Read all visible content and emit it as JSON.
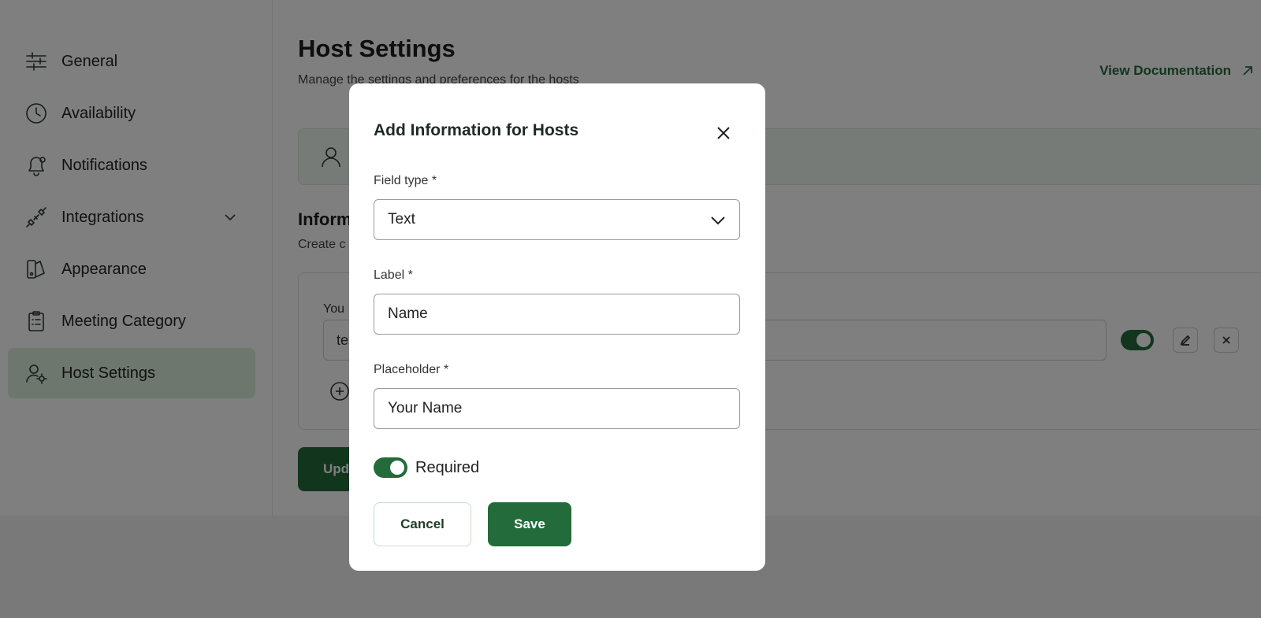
{
  "sidebar": {
    "items": [
      {
        "label": "General",
        "icon": "sliders-icon"
      },
      {
        "label": "Availability",
        "icon": "clock-icon"
      },
      {
        "label": "Notifications",
        "icon": "bell-icon"
      },
      {
        "label": "Integrations",
        "icon": "plug-icon"
      },
      {
        "label": "Appearance",
        "icon": "palette-icon"
      },
      {
        "label": "Meeting Category",
        "icon": "clipboard-icon"
      },
      {
        "label": "Host Settings",
        "icon": "user-gear-icon"
      }
    ],
    "active_index": 6
  },
  "main": {
    "title": "Host Settings",
    "subtitle": "Manage the settings and preferences for the hosts",
    "view_documentation": "View Documentation",
    "section_title": "Inform",
    "section_subtitle": "Create c",
    "field_label": "You",
    "field_value": "te",
    "update_button": "Upd"
  },
  "modal": {
    "title": "Add Information for Hosts",
    "field_type_label": "Field type *",
    "field_type_value": "Text",
    "label_label": "Label *",
    "label_value": "Name",
    "placeholder_label": "Placeholder *",
    "placeholder_value": "Your Name",
    "required_label": "Required",
    "required_on": true,
    "cancel_label": "Cancel",
    "save_label": "Save"
  },
  "colors": {
    "accent": "#246b3b",
    "active_nav": "#dbeedd",
    "overlay": "rgba(0,0,0,0.5)"
  }
}
